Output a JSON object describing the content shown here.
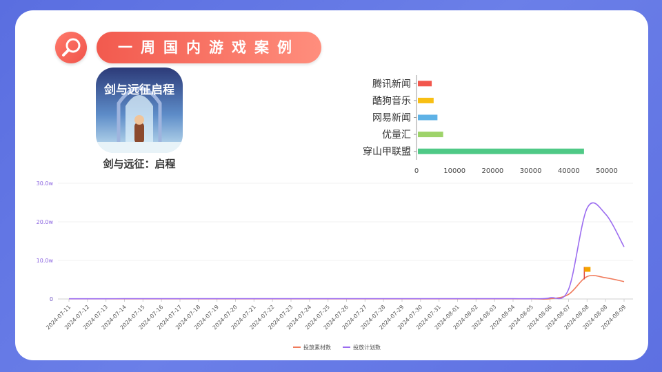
{
  "header": {
    "title": "一周国内游戏案例"
  },
  "app": {
    "name": "剑与远征：启程",
    "icon_text": "剑与远征启程"
  },
  "colors": {
    "accent": "#f25a4e",
    "line_material": "#f07b5c",
    "line_plan": "#9b6cf0"
  },
  "chart_data": [
    {
      "type": "bar",
      "orientation": "horizontal",
      "categories": [
        "腾讯新闻",
        "酷狗音乐",
        "网易新闻",
        "优量汇",
        "穿山甲联盟"
      ],
      "values": [
        4000,
        4500,
        5500,
        7000,
        44000
      ],
      "colors": [
        "#f2574d",
        "#f8bf14",
        "#5eb2e6",
        "#9ed36a",
        "#4fc986"
      ],
      "xticks": [
        "0",
        "10000",
        "20000",
        "30000",
        "40000",
        "50000"
      ],
      "xlim": [
        0,
        50000
      ]
    },
    {
      "type": "line",
      "x": [
        "2024-07-11",
        "2024-07-12",
        "2024-07-13",
        "2024-07-14",
        "2024-07-15",
        "2024-07-16",
        "2024-07-17",
        "2024-07-18",
        "2024-07-19",
        "2024-07-20",
        "2024-07-21",
        "2024-07-22",
        "2024-07-23",
        "2024-07-24",
        "2024-07-25",
        "2024-07-26",
        "2024-07-27",
        "2024-07-28",
        "2024-07-29",
        "2024-07-30",
        "2024-07-31",
        "2024-08-01",
        "2024-08-02",
        "2024-08-03",
        "2024-08-04",
        "2024-08-05",
        "2024-08-06",
        "2024-08-07",
        "2024-08-08",
        "2024-08-08",
        "2024-08-09"
      ],
      "yticks": [
        "0",
        "10.0w",
        "20.0w",
        "30.0w"
      ],
      "ylim": [
        0,
        300000
      ],
      "series": [
        {
          "name": "投放素材数",
          "color": "#f07b5c",
          "values": [
            400,
            400,
            400,
            400,
            400,
            400,
            400,
            400,
            400,
            400,
            400,
            400,
            400,
            400,
            400,
            400,
            400,
            400,
            400,
            400,
            400,
            400,
            400,
            400,
            400,
            400,
            500,
            12000,
            58000,
            55000,
            45000
          ]
        },
        {
          "name": "投放计划数",
          "color": "#9b6cf0",
          "values": [
            600,
            600,
            600,
            700,
            700,
            700,
            700,
            700,
            700,
            700,
            700,
            700,
            700,
            700,
            700,
            700,
            700,
            700,
            700,
            700,
            700,
            700,
            700,
            700,
            700,
            800,
            3000,
            25000,
            235000,
            220000,
            135000
          ]
        }
      ],
      "legend_position": "bottom"
    }
  ]
}
